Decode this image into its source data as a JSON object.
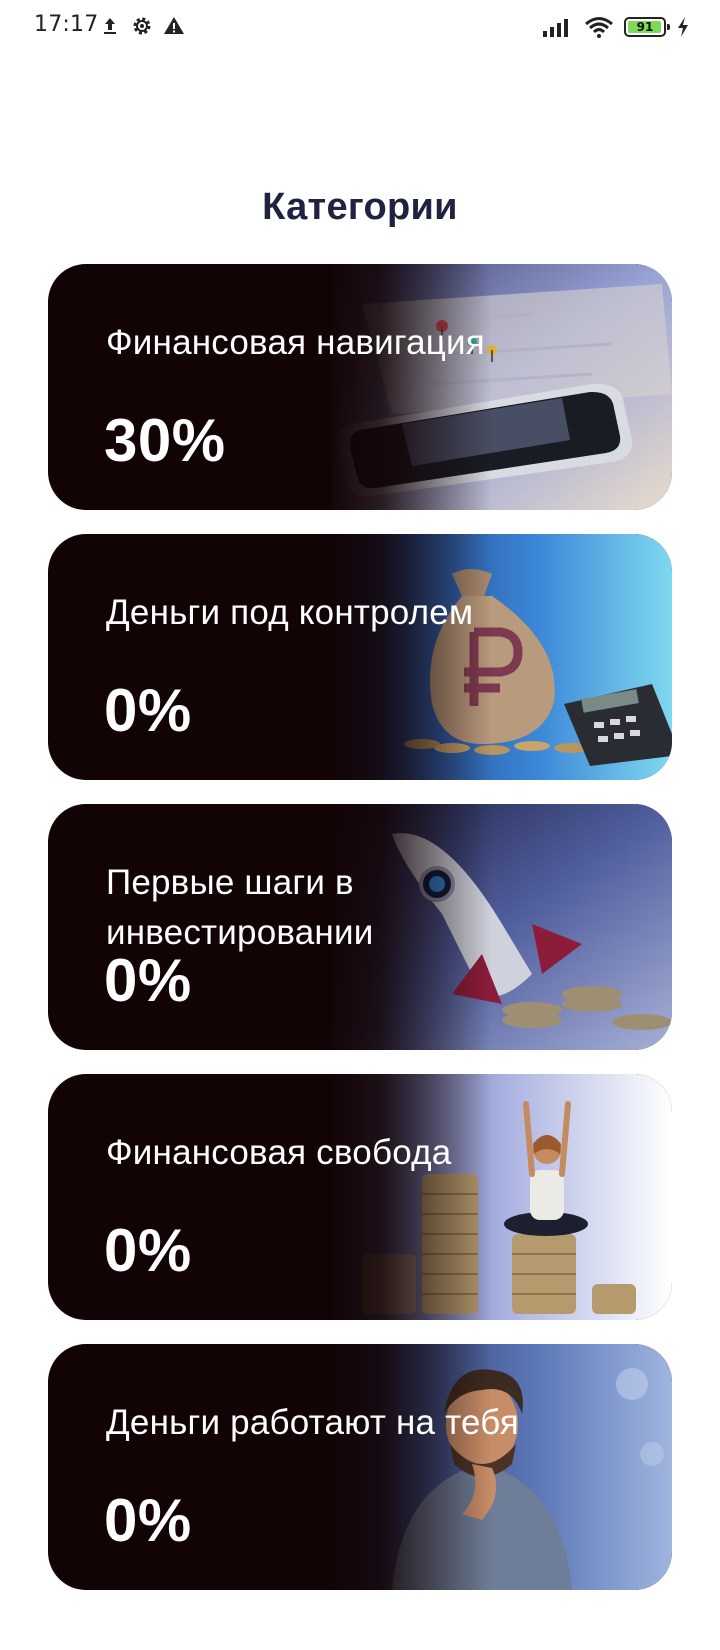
{
  "status_bar": {
    "time": "17:17",
    "left_icons": [
      "upload-icon",
      "settings-icon",
      "warning-icon"
    ],
    "right_icons": [
      "signal-icon",
      "wifi-icon",
      "battery-icon",
      "charging-icon"
    ],
    "battery_level": "91",
    "battery_fraction": 0.91
  },
  "header": {
    "title": "Категории"
  },
  "categories": [
    {
      "title": "Финансовая навигация",
      "percent": "30%",
      "image": "map-and-phone",
      "accent": "#8a93c8"
    },
    {
      "title": "Деньги под контролем",
      "percent": "0%",
      "image": "money-bag-ruble",
      "accent": "#3a7fd4"
    },
    {
      "title": "Первые шаги в инвестировании",
      "percent": "0%",
      "image": "rocket-coins",
      "accent": "#4b5a9c"
    },
    {
      "title": "Финансовая свобода",
      "percent": "0%",
      "image": "woman-on-coins",
      "accent": "#c8cff2"
    },
    {
      "title": "Деньги работают на тебя",
      "percent": "0%",
      "image": "thinking-man",
      "accent": "#5a73b6"
    }
  ],
  "colors": {
    "card_background": "#120304",
    "title_text": "#1f2240",
    "card_text": "#ffffff"
  }
}
